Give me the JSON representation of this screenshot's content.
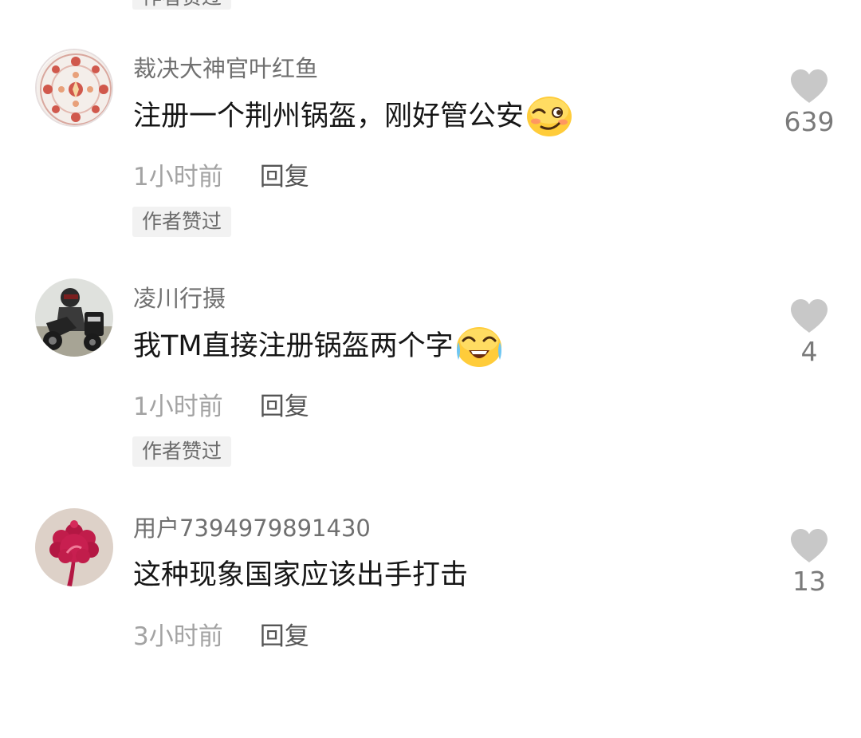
{
  "top_partial_badge": "作者赞过",
  "comments": [
    {
      "username": "裁决大神官叶红鱼",
      "text": "注册一个荆州锅盔，刚好管公安",
      "emoji": "smirking-face-emoji",
      "time": "1小时前",
      "reply_label": "回复",
      "badge": "作者赞过",
      "likes": "639",
      "avatar": "mandala-avatar"
    },
    {
      "username": "凌川行摄",
      "text": "我TM直接注册锅盔两个字",
      "emoji": "crying-laughing-face-emoji",
      "time": "1小时前",
      "reply_label": "回复",
      "badge": "作者赞过",
      "likes": "4",
      "avatar": "motorcycle-rider-avatar"
    },
    {
      "username": "用户7394979891430",
      "text": "这种现象国家应该出手打击",
      "time": "3小时前",
      "reply_label": "回复",
      "likes": "13",
      "avatar": "red-flower-avatar"
    }
  ],
  "colors": {
    "username": "#707070",
    "text": "#161616",
    "time": "#a3a3a3",
    "reply": "#555555",
    "badge_bg": "#f2f2f2",
    "like_icon": "#c8c8c8"
  }
}
